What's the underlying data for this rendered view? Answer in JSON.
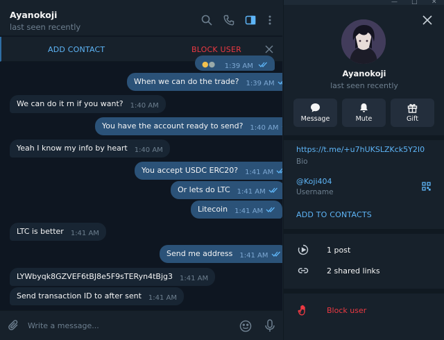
{
  "chat": {
    "title": "Ayanokoji",
    "status": "last seen recently",
    "header_icons": [
      "search-icon",
      "phone-icon",
      "sidebar-toggle-icon",
      "more-vertical-icon"
    ]
  },
  "action_bar": {
    "add_contact": "ADD CONTACT",
    "block_user": "BLOCK USER"
  },
  "messages": [
    {
      "dir": "out",
      "text": "When we can do the trade?",
      "time": "1:39 AM"
    },
    {
      "dir": "in",
      "text": "We can do it rn if you want?",
      "time": "1:40 AM"
    },
    {
      "dir": "out",
      "text": "You have the account ready to send?",
      "time": "1:40 AM"
    },
    {
      "dir": "in",
      "text": "Yeah I know my info by heart",
      "time": "1:40 AM"
    },
    {
      "dir": "out",
      "text": "You accept USDC ERC20?",
      "time": "1:41 AM"
    },
    {
      "dir": "out",
      "text": "Or lets do LTC",
      "time": "1:41 AM"
    },
    {
      "dir": "out",
      "text": "Litecoin",
      "time": "1:41 AM"
    },
    {
      "dir": "in",
      "text": "LTC is better",
      "time": "1:41 AM"
    },
    {
      "dir": "out",
      "text": "Send me address",
      "time": "1:41 AM"
    },
    {
      "dir": "in",
      "text": "LYWbyqk8GZVEF6tBJ8e5F9sTERyn4tBjg3",
      "time": "1:41 AM"
    },
    {
      "dir": "in",
      "text": "Send transaction ID to after sent",
      "time": "1:41 AM"
    }
  ],
  "partial_message": {
    "time": "1:39 AM"
  },
  "composer": {
    "placeholder": "Write a message..."
  },
  "profile": {
    "name": "Ayanokoji",
    "status": "last seen recently",
    "buttons": [
      {
        "label": "Message",
        "icon": "message-icon"
      },
      {
        "label": "Mute",
        "icon": "bell-icon"
      },
      {
        "label": "Gift",
        "icon": "gift-icon"
      }
    ],
    "bio_link": "https://t.me/+u7hUKSLZKck5Y2I0",
    "bio_label": "Bio",
    "username": "@Koji404",
    "username_label": "Username",
    "add_to_contacts": "ADD TO CONTACTS",
    "posts": "1 post",
    "shared_links": "2 shared links",
    "block_user": "Block user"
  },
  "colors": {
    "accent": "#5eb5f7",
    "danger": "#ec3942",
    "bubble_out": "#2b5278",
    "bubble_in": "#182533",
    "chat_bg": "#0e1621",
    "panel_bg": "#17212b"
  }
}
